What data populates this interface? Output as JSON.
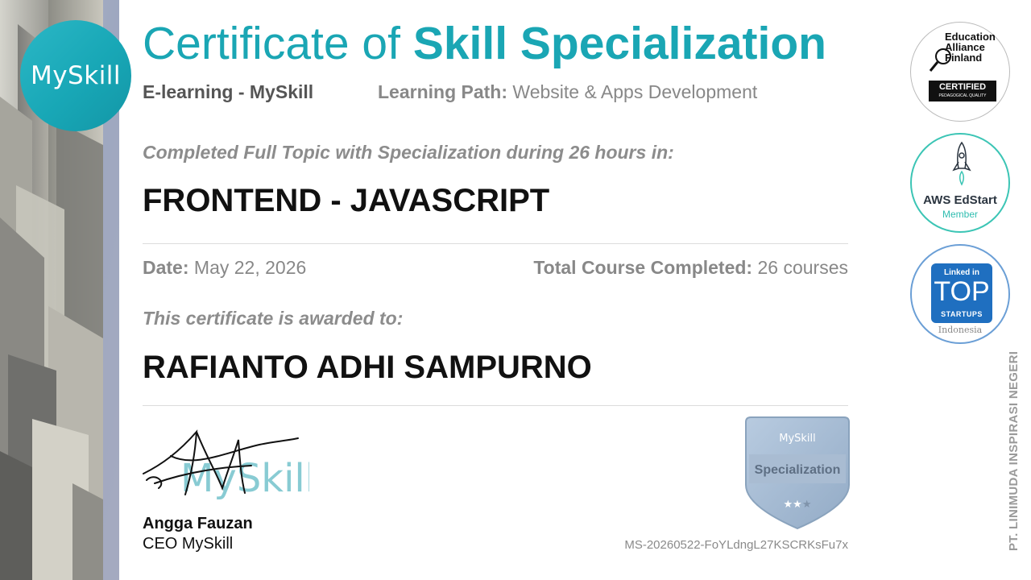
{
  "logo": {
    "text": "MySkill"
  },
  "title": {
    "prefix": "Certificate of",
    "emphasis": "Skill Specialization"
  },
  "provider": "E-learning - MySkill",
  "learning_path": {
    "label": "Learning Path:",
    "value": "Website & Apps Development"
  },
  "completed_text": "Completed Full Topic with Specialization during 26 hours in:",
  "topic": "FRONTEND - JAVASCRIPT",
  "date": {
    "label": "Date:",
    "value": "May 22, 2026"
  },
  "total_courses": {
    "label": "Total Course Completed:",
    "value": "26 courses"
  },
  "awarded_text": "This certificate is awarded to:",
  "recipient": "RAFIANTO ADHI SAMPURNO",
  "signature_text": "MySkill",
  "signer": {
    "name": "Angga Fauzan",
    "title": "CEO MySkill"
  },
  "specialization_badge": {
    "brand": "MySkill",
    "label": "Specialization",
    "stars_filled": 2,
    "stars_total": 3
  },
  "certificate_id": "MS-20260522-FoYLdngL27KSCRKsFu7x",
  "badges": {
    "education_alliance": {
      "line1": "Education",
      "line2": "Alliance",
      "line3": "Finland",
      "certified": "CERTIFIED",
      "quality": "PEDAGOGICAL QUALITY"
    },
    "aws": {
      "title": "AWS EdStart",
      "subtitle": "Member"
    },
    "linkedin": {
      "brand": "Linked in",
      "top": "TOP",
      "startups": "STARTUPS",
      "country": "Indonesia"
    }
  },
  "company": "PT. LINIMUDA INSPIRASI NEGERI",
  "colors": {
    "brand_teal": "#1aa6b4",
    "muted_text": "#888888",
    "linkedin_blue": "#1f6fc0",
    "aws_teal": "#3cc5b5"
  }
}
